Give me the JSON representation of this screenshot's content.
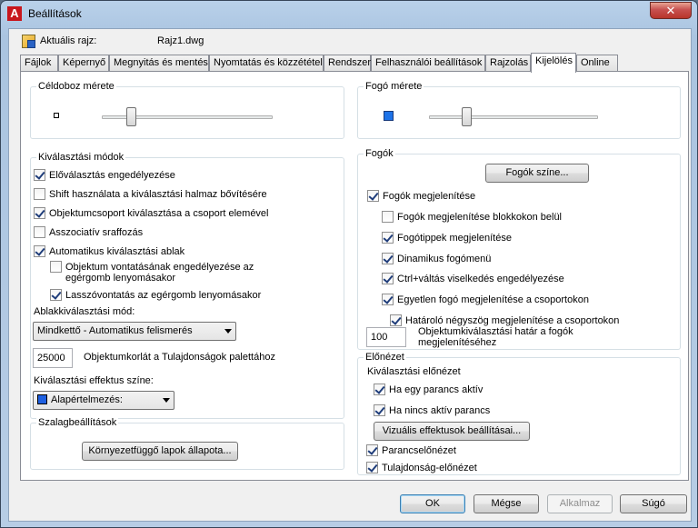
{
  "window": {
    "title": "Beállítások",
    "close_glyph": "✕",
    "app_icon_letter": "A"
  },
  "profile": {
    "label": "Aktuális rajz:",
    "value": "Rajz1.dwg"
  },
  "tabs": [
    {
      "label": "Fájlok"
    },
    {
      "label": "Képernyő"
    },
    {
      "label": "Megnyitás és mentés"
    },
    {
      "label": "Nyomtatás és közzététel"
    },
    {
      "label": "Rendszer"
    },
    {
      "label": "Felhasználói beállítások"
    },
    {
      "label": "Rajzolás"
    },
    {
      "label": "Kijelölés"
    },
    {
      "label": "Online"
    }
  ],
  "pickbox": {
    "title": "Céldoboz mérete",
    "slider_level": 0.18
  },
  "grip_size": {
    "title": "Fogó mérete",
    "slider_level": 0.22
  },
  "selection_modes": {
    "title": "Kiválasztási módok",
    "items": [
      {
        "label": "Előválasztás engedélyezése",
        "checked": true
      },
      {
        "label": "Shift használata a kiválasztási halmaz bővítésére",
        "checked": false
      },
      {
        "label": "Objektumcsoport kiválasztása a csoport elemével",
        "checked": true
      },
      {
        "label": "Asszociatív sraffozás",
        "checked": false
      },
      {
        "label": "Automatikus kiválasztási ablak",
        "checked": true
      }
    ],
    "drag_line1": "Objektum vontatásának engedélyezése az",
    "drag_line2": "egérgomb lenyomásakor",
    "drag_checked": false,
    "lasso": "Lasszóvontatás az egérgomb lenyomásakor",
    "lasso_checked": true,
    "window_mode_label": "Ablakkiválasztási mód:",
    "window_mode_value": "Mindkettő - Automatikus felismerés",
    "object_limit_value": "25000",
    "object_limit_label": "Objektumkorlát a Tulajdonságok palettához",
    "effect_color_label": "Kiválasztási effektus színe:",
    "effect_color_value": "Alapértelmezés:",
    "effect_color_swatch": "#1e5fe0"
  },
  "ribbon": {
    "title": "Szalagbeállítások",
    "button": "Környezetfüggő lapok állapota..."
  },
  "grips": {
    "title": "Fogók",
    "colors_button": "Fogók színe...",
    "items": [
      {
        "label": "Fogók megjelenítése",
        "checked": true,
        "indent": 0
      },
      {
        "label": "Fogók megjelenítése blokkokon belül",
        "checked": false,
        "indent": 1
      },
      {
        "label": "Fogótippek megjelenítése",
        "checked": true,
        "indent": 1
      },
      {
        "label": "Dinamikus fogómenü",
        "checked": true,
        "indent": 1
      },
      {
        "label": "Ctrl+váltás viselkedés engedélyezése",
        "checked": true,
        "indent": 1
      },
      {
        "label": "Egyetlen fogó megjelenítése a csoportokon",
        "checked": true,
        "indent": 1
      },
      {
        "label": "Határoló négyszög megjelenítése a csoportokon",
        "checked": true,
        "indent": 2
      }
    ],
    "limit_value": "100",
    "limit_line1": "Objektumkiválasztási határ a fogók",
    "limit_line2": "megjelenítéséhez",
    "grip_swatch": "#1e73e8"
  },
  "preview": {
    "title": "Előnézet",
    "sub_title": "Kiválasztási előnézet",
    "active_cmd": "Ha egy parancs aktív",
    "active_cmd_checked": true,
    "no_cmd": "Ha nincs aktív parancs",
    "no_cmd_checked": true,
    "visual_effects_button": "Vizuális effektusok beállításai...",
    "cmd_preview": "Parancselőnézet",
    "cmd_preview_checked": true,
    "prop_preview": "Tulajdonság-előnézet",
    "prop_preview_checked": true
  },
  "footer": {
    "ok": "OK",
    "cancel": "Mégse",
    "apply": "Alkalmaz",
    "help": "Súgó"
  }
}
